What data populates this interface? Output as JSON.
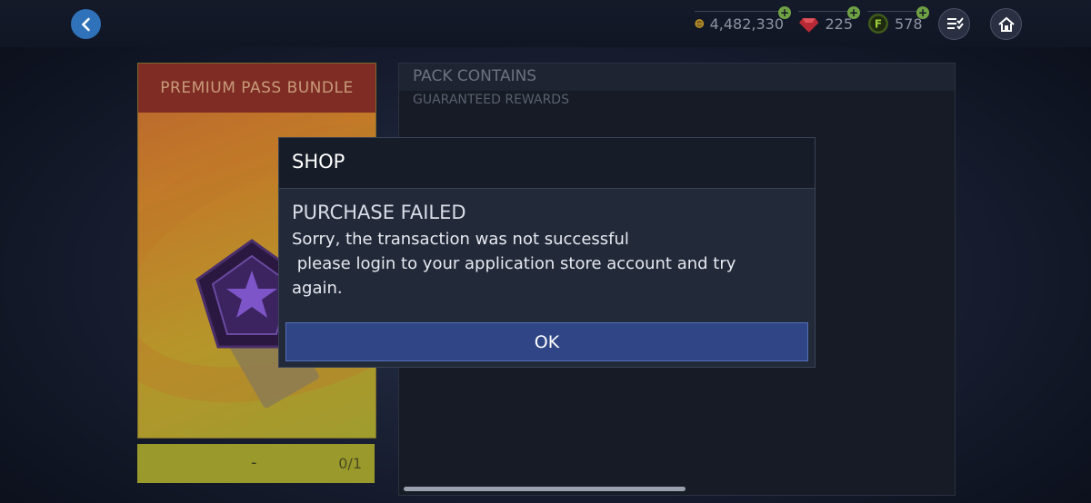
{
  "currencies": {
    "coins": {
      "value": "4,482,330",
      "icon": "fifa-coin-icon"
    },
    "gems": {
      "value": "225",
      "icon": "gem-icon"
    },
    "points": {
      "value": "578",
      "icon": "fifa-points-icon"
    }
  },
  "bundle": {
    "title": "PREMIUM PASS BUNDLE",
    "price": "-",
    "count": "0/1"
  },
  "contents": {
    "title": "PACK CONTAINS",
    "subtitle": "GUARANTEED REWARDS"
  },
  "dialog": {
    "title": "SHOP",
    "heading": "PURCHASE FAILED",
    "message": "Sorry, the transaction was not successful\n please login to your application store account and try again.",
    "ok_label": "OK"
  },
  "colors": {
    "accent_blue": "#2f4586",
    "plus_green": "#6fa245",
    "bundle_header": "#7f2d24"
  }
}
